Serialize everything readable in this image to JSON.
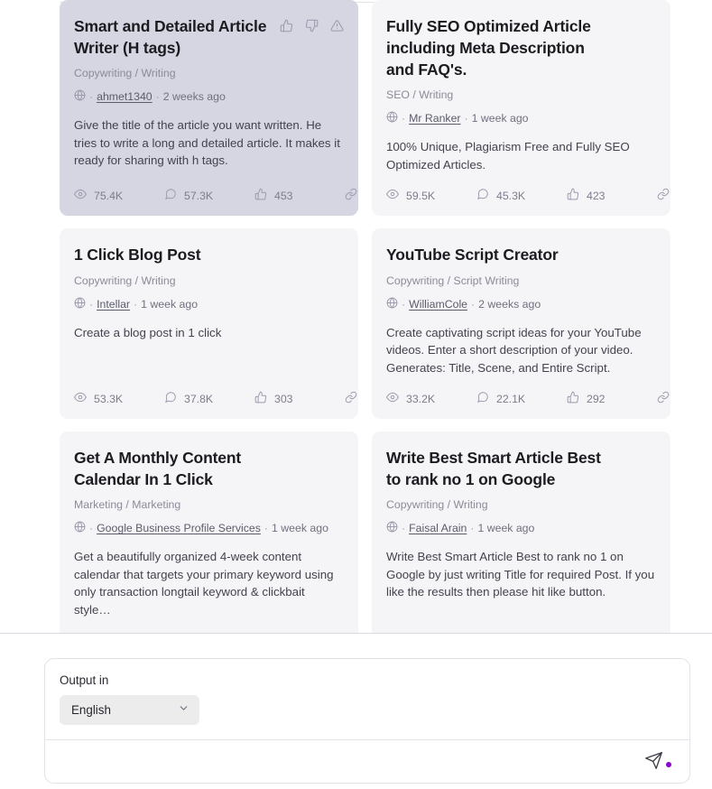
{
  "cards": [
    {
      "id": "smart-and-detailed-article-writer",
      "selected": true,
      "title": "Smart and Detailed Article Writer (H tags)",
      "category": "Copywriting / Writing",
      "author": "ahmet1340",
      "time": "2 weeks ago",
      "description": "Give the title of the article you want written. He tries to write a long and detailed article. It makes it ready for sharing with h tags.",
      "views": "75.4K",
      "comments": "57.3K",
      "likes": "453",
      "has_feedback_actions": true
    },
    {
      "id": "fully-seo-optimized-article",
      "selected": false,
      "title": "Fully SEO Optimized Article including Meta Description and FAQ's.",
      "category": "SEO / Writing",
      "author": "Mr Ranker",
      "time": "1 week ago",
      "description": "100% Unique, Plagiarism Free and Fully SEO Optimized Articles.",
      "views": "59.5K",
      "comments": "45.3K",
      "likes": "423",
      "has_feedback_actions": false
    },
    {
      "id": "1-click-blog-post",
      "selected": false,
      "title": "1 Click Blog Post",
      "category": "Copywriting / Writing",
      "author": "Intellar",
      "time": "1 week ago",
      "description": "Create a blog post in 1 click",
      "views": "53.3K",
      "comments": "37.8K",
      "likes": "303",
      "has_feedback_actions": false
    },
    {
      "id": "youtube-script-creator",
      "selected": false,
      "title": "YouTube Script Creator",
      "category": "Copywriting / Script Writing",
      "author": "WilliamCole",
      "time": "2 weeks ago",
      "description": "Create captivating script ideas for your YouTube videos. Enter a short description of your video. Generates: Title, Scene, and Entire Script.",
      "views": "33.2K",
      "comments": "22.1K",
      "likes": "292",
      "has_feedback_actions": false
    },
    {
      "id": "get-a-monthly-content-calendar",
      "selected": false,
      "title": "Get A Monthly Content Calendar In 1 Click",
      "category": "Marketing / Marketing",
      "author": "Google Business Profile Services",
      "time": "1 week ago",
      "description": "Get a beautifully organized 4-week content calendar that targets your primary keyword using only transaction longtail keyword & clickbait style…",
      "views": "",
      "comments": "",
      "likes": "",
      "has_feedback_actions": false
    },
    {
      "id": "write-best-smart-article",
      "selected": false,
      "title": "Write Best Smart Article Best to rank no 1 on Google",
      "category": "Copywriting / Writing",
      "author": "Faisal Arain",
      "time": "1 week ago",
      "description": "Write Best Smart Article Best to rank no 1 on Google by just writing Title for required Post. If you like the results then please hit like button.",
      "views": "",
      "comments": "",
      "likes": "",
      "has_feedback_actions": false
    }
  ],
  "composer": {
    "output_label": "Output in",
    "language_value": "English",
    "input_value": "",
    "input_placeholder": "",
    "send_label": "Send"
  },
  "icons": {
    "thumbs_up": "thumbs-up-icon",
    "thumbs_down": "thumbs-down-icon",
    "report": "report-warning-icon",
    "globe": "globe-icon",
    "eye": "eye-icon",
    "comment": "comment-icon",
    "link": "link-icon",
    "chevron_down": "chevron-down-icon",
    "send": "send-paper-plane-icon"
  },
  "colors": {
    "card_bg": "#f5f5f7",
    "card_selected_bg": "#d5d6e1",
    "accent": "#8a08c8",
    "muted_text": "#8b8b99",
    "title_text": "#1b1b20"
  }
}
